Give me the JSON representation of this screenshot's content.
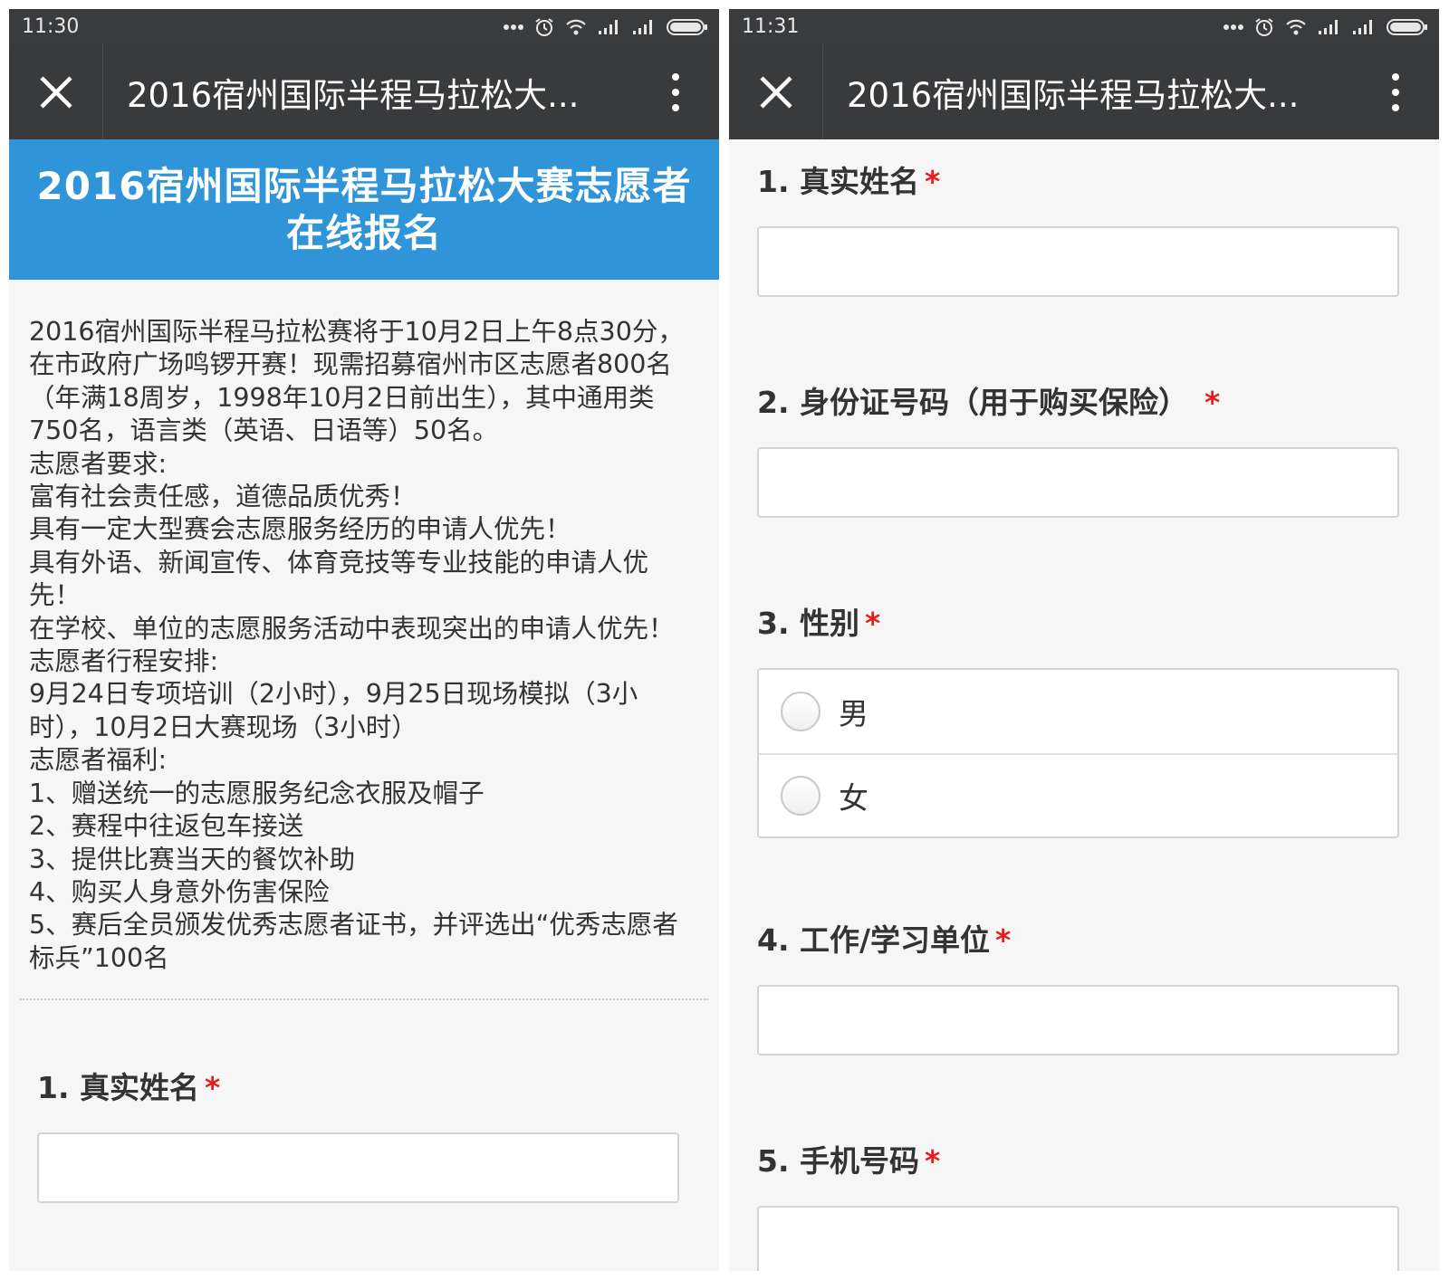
{
  "left": {
    "status_time": "11:30",
    "nav_title": "2016宿州国际半程马拉松大...",
    "banner_title": "2016宿州国际半程马拉松大赛志愿者在线报名",
    "intro_lines": [
      "2016宿州国际半程马拉松赛将于10月2日上午8点30分，在市政府广场鸣锣开赛！现需招募宿州市区志愿者800名（年满18周岁，1998年10月2日前出生），其中通用类750名，语言类（英语、日语等）50名。",
      "志愿者要求:",
      "富有社会责任感，道德品质优秀！",
      "具有一定大型赛会志愿服务经历的申请人优先！",
      "具有外语、新闻宣传、体育竞技等专业技能的申请人优先！",
      "在学校、单位的志愿服务活动中表现突出的申请人优先！",
      "志愿者行程安排:",
      "9月24日专项培训（2小时），9月25日现场模拟（3小时），10月2日大赛现场（3小时）",
      "志愿者福利:",
      "1、赠送统一的志愿服务纪念衣服及帽子",
      "2、赛程中往返包车接送",
      "3、提供比赛当天的餐饮补助",
      "4、购买人身意外伤害保险",
      "5、赛后全员颁发优秀志愿者证书，并评选出“优秀志愿者标兵”100名"
    ],
    "q1_label": "1. 真实姓名"
  },
  "right": {
    "status_time": "11:31",
    "nav_title": "2016宿州国际半程马拉松大...",
    "q1_label": "1. 真实姓名",
    "q2_label": "2. 身份证号码（用于购买保险）",
    "q3_label": "3. 性别",
    "gender_options": [
      "男",
      "女"
    ],
    "q4_label": "4. 工作/学习单位",
    "q5_label": "5. 手机号码"
  },
  "required_mark": "*",
  "colors": {
    "status_bar": "#3a3b3d",
    "nav_bar": "#393a3c",
    "banner": "#2f95d8",
    "required": "#e02020",
    "page_bg": "#f6f6f6"
  },
  "icons": [
    "more-dots-icon",
    "alarm-icon",
    "wifi-icon",
    "signal-icon",
    "battery-icon",
    "close-icon",
    "more-vertical-icon"
  ]
}
